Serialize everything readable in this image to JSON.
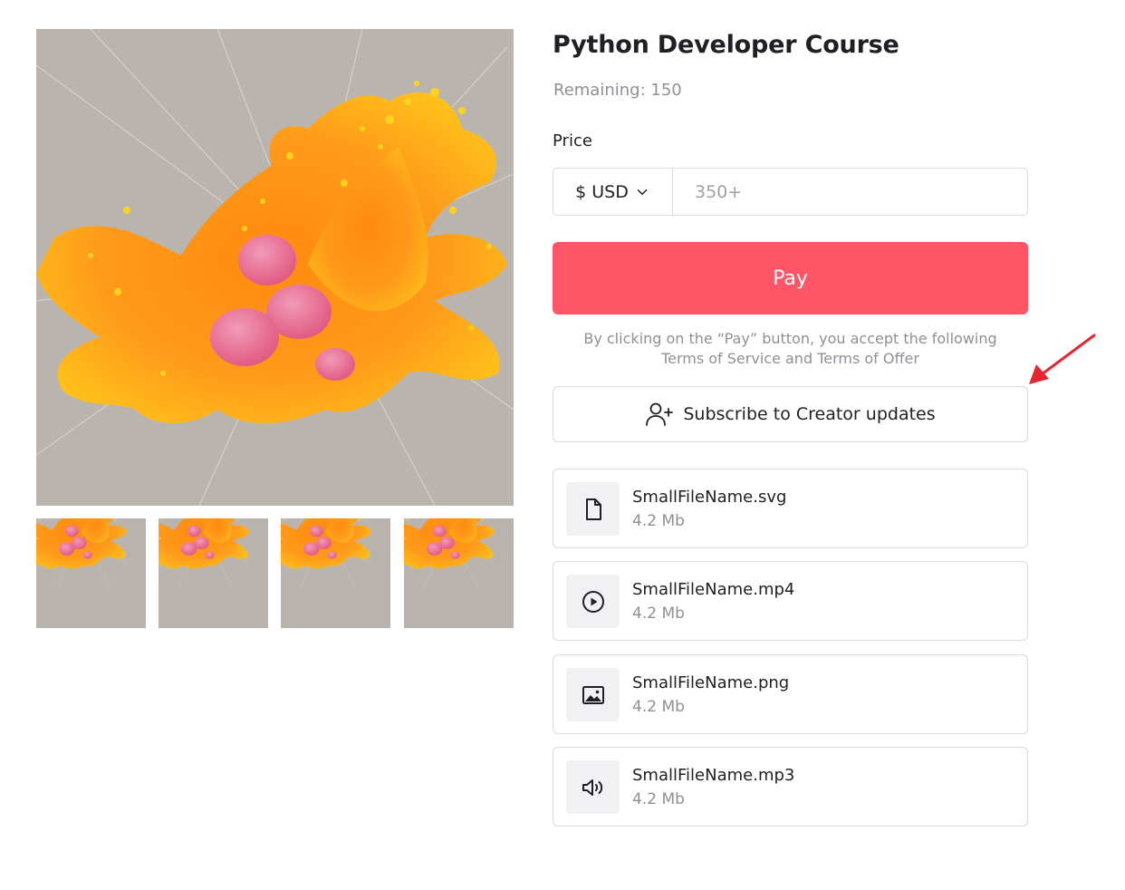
{
  "product": {
    "title": "Python Developer Course",
    "remaining": "Remaining: 150"
  },
  "price": {
    "label": "Price",
    "currency": "$ USD",
    "amount_placeholder": "350+"
  },
  "pay": {
    "label": "Pay",
    "color": "#ff5566"
  },
  "terms": {
    "prefix": "By clicking on the “Pay” button, you accept the following",
    "tos_link": "Terms of Service",
    "and": " and ",
    "offer_link": "Terms of Offer"
  },
  "subscribe": {
    "label": "Subscribe to Creator updates",
    "icon": "user-plus-icon"
  },
  "annotation": {
    "arrow_color": "#e8242e"
  },
  "files": [
    {
      "name": "SmallFileName.svg",
      "size": "4.2 Mb",
      "icon": "document-icon"
    },
    {
      "name": "SmallFileName.mp4",
      "size": "4.2 Mb",
      "icon": "play-circle-icon"
    },
    {
      "name": "SmallFileName.png",
      "size": "4.2 Mb",
      "icon": "image-icon"
    },
    {
      "name": "SmallFileName.mp3",
      "size": "4.2 Mb",
      "icon": "speaker-icon"
    }
  ]
}
